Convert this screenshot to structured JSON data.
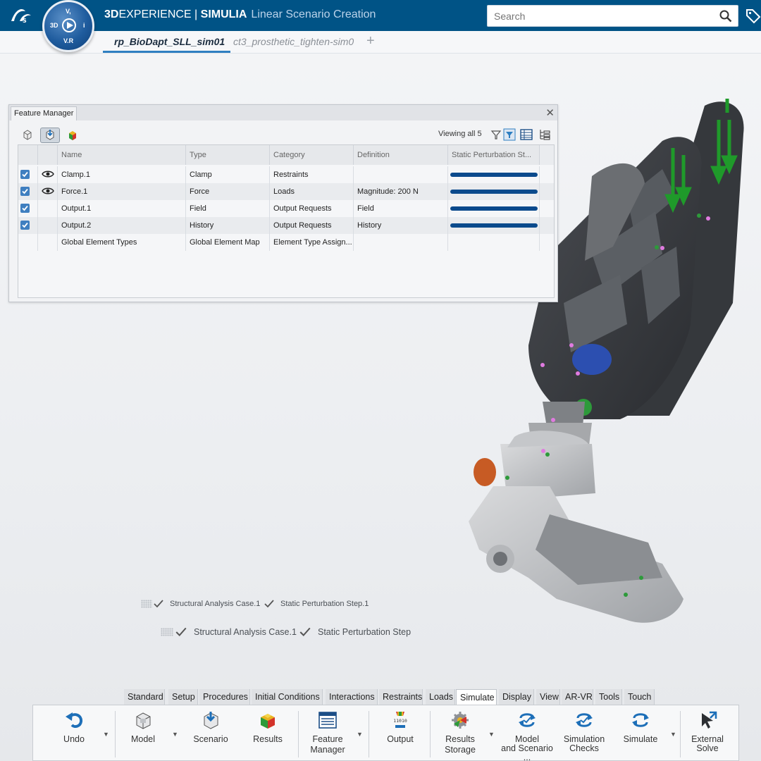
{
  "header": {
    "brand_bold": "3D",
    "brand_rest": "EXPERIENCE",
    "sep": " | ",
    "product": "SIMULIA",
    "app": "Linear Scenario Creation",
    "compass": {
      "top": "V,",
      "left": "3D",
      "right": "i",
      "bottom": "V.R"
    }
  },
  "search": {
    "placeholder": "Search"
  },
  "tabs": [
    {
      "label": "rp_BioDapt_SLL_sim01",
      "active": true
    },
    {
      "label": "ct3_prosthetic_tighten-sim0",
      "active": false
    }
  ],
  "feature_manager": {
    "title": "Feature Manager",
    "viewing": "Viewing all 5",
    "columns": [
      "Name",
      "Type",
      "Category",
      "Definition",
      "Static Perturbation St..."
    ],
    "rows": [
      {
        "checked": true,
        "visible": true,
        "name": "Clamp.1",
        "type": "Clamp",
        "category": "Restraints",
        "definition": "",
        "progress": 1.0
      },
      {
        "checked": true,
        "visible": true,
        "name": "Force.1",
        "type": "Force",
        "category": "Loads",
        "definition": "Magnitude: 200 N",
        "progress": 1.0
      },
      {
        "checked": true,
        "visible": false,
        "name": "Output.1",
        "type": "Field",
        "category": "Output Requests",
        "definition": "Field",
        "progress": 1.0
      },
      {
        "checked": true,
        "visible": false,
        "name": "Output.2",
        "type": "History",
        "category": "Output Requests",
        "definition": "History",
        "progress": 1.0
      },
      {
        "checked": false,
        "visible": false,
        "name": "Global Element Types",
        "type": "Global Element Map",
        "category": "Element Type Assign...",
        "definition": "",
        "progress": 0
      }
    ]
  },
  "timeline": {
    "row1": [
      "Structural Analysis Case.1",
      "Static Perturbation Step.1"
    ],
    "row2": [
      "Structural Analysis Case.1",
      "Static Perturbation Step"
    ]
  },
  "ribbon": {
    "tabs": [
      "Standard",
      "Setup",
      "Procedures",
      "Initial Conditions",
      "Interactions",
      "Restraints",
      "Loads",
      "Simulate",
      "Display",
      "View",
      "AR-VR",
      "Tools",
      "Touch"
    ],
    "active_tab": "Simulate",
    "buttons": [
      {
        "label": "Undo",
        "icon": "undo-icon"
      },
      {
        "label": "Model",
        "icon": "model-icon"
      },
      {
        "label": "Scenario",
        "icon": "scenario-icon"
      },
      {
        "label": "Results",
        "icon": "results-icon"
      },
      {
        "label": "Feature Manager",
        "line1": "Feature",
        "line2": "Manager",
        "icon": "feature-manager-icon"
      },
      {
        "label": "Output",
        "icon": "output-icon"
      },
      {
        "label": "Results Storage",
        "line1": "Results",
        "line2": "Storage",
        "icon": "results-storage-icon"
      },
      {
        "label": "Model and Scenario ...",
        "line1": "Model",
        "line2": "and Scenario ...",
        "icon": "model-scenario-icon"
      },
      {
        "label": "Simulation Checks",
        "line1": "Simulation",
        "line2": "Checks",
        "icon": "simulation-checks-icon"
      },
      {
        "label": "Simulate",
        "icon": "simulate-icon"
      },
      {
        "label": "External Solve",
        "line1": "External",
        "line2": "Solve",
        "icon": "external-solve-icon"
      }
    ]
  },
  "colors": {
    "header": "#005386",
    "accent": "#2f7fc1",
    "progress": "#0b4a8c",
    "load_arrow": "#1f9a2a"
  }
}
